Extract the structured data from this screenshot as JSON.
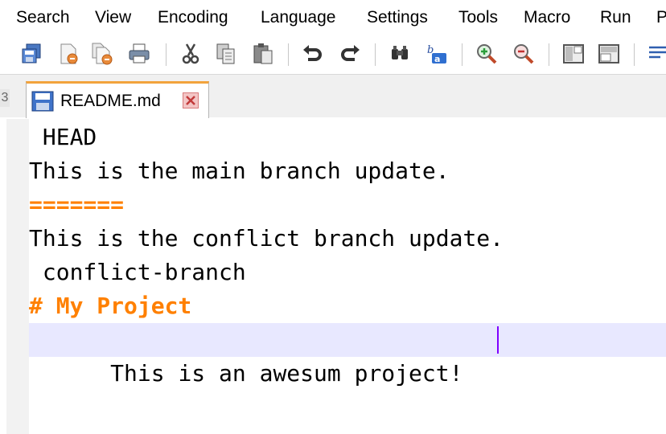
{
  "menu": {
    "items": [
      "Search",
      "View",
      "Encoding",
      "Language",
      "Settings",
      "Tools",
      "Macro",
      "Run",
      "P"
    ]
  },
  "toolbar": {
    "buttons": [
      "save-all-icon",
      "close-icon",
      "close-all-icon",
      "print-icon",
      "cut-icon",
      "copy-icon",
      "paste-icon",
      "undo-icon",
      "redo-icon",
      "find-icon",
      "replace-icon",
      "zoom-in-icon",
      "zoom-out-icon",
      "sync-vertical-icon",
      "sync-horizontal-icon",
      "word-wrap-icon"
    ]
  },
  "tabs": {
    "scroll_left_label": "3",
    "active": {
      "label": "README.md"
    }
  },
  "editor": {
    "lines": [
      " HEAD",
      "This is the main branch update.",
      "=======",
      "This is the conflict branch update.",
      " conflict-branch",
      "# My Project",
      "This is an awesum project! "
    ]
  },
  "colors": {
    "accent_orange": "#ff8000",
    "current_line": "#e8e8ff",
    "caret": "#8000ff",
    "tab_top_border": "#f2a33c"
  }
}
